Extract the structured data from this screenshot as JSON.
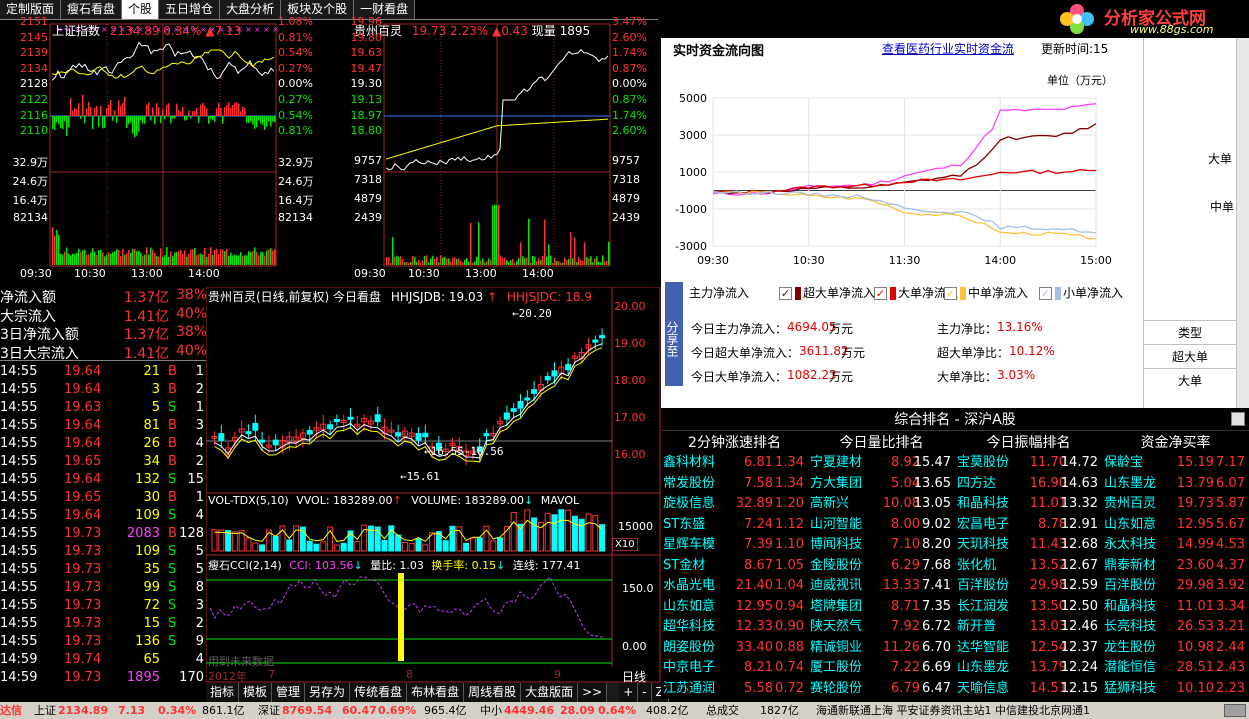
{
  "tabs": [
    "定制版面",
    "瘦石看盘",
    "个股",
    "五日增仓",
    "大盘分析",
    "板块及个股",
    "一财看盘"
  ],
  "active_tab": 2,
  "logo": {
    "name": "分析家公式网",
    "url": "www.88gs.com"
  },
  "index_chart": {
    "title": "上证指数",
    "price": "2134.89",
    "pct": "0.34%",
    "chg": "▲7.13",
    "left_ticks": [
      "2151",
      "2145",
      "2139",
      "2134",
      "2128",
      "2122",
      "2116",
      "2110"
    ],
    "right_ticks": [
      "1.08%",
      "0.81%",
      "0.54%",
      "0.27%",
      "0.00%",
      "0.27%",
      "0.54%",
      "0.81%"
    ],
    "vol_left": [
      "32.9万",
      "24.6万",
      "16.4万",
      "82134"
    ],
    "vol_right": [
      "32.9万",
      "24.6万",
      "16.4万",
      "82134"
    ],
    "times": [
      "09:30",
      "10:30",
      "13:00",
      "14:00"
    ]
  },
  "stock_chart": {
    "title": "贵州百灵",
    "price": "19.73",
    "pct": "2.23%",
    "chg": "▲0.43",
    "extra": "现量 1895",
    "left_ticks": [
      "19.96",
      "19.80",
      "19.63",
      "19.47",
      "19.30",
      "19.13",
      "18.97",
      "18.80"
    ],
    "right_ticks": [
      "3.47%",
      "2.60%",
      "1.74%",
      "0.87%",
      "0.00%",
      "0.87%",
      "1.74%",
      "2.60%"
    ],
    "vol_left": [
      "9757",
      "7318",
      "4879",
      "2439"
    ],
    "vol_right": [
      "9757",
      "7318",
      "4879",
      "2439"
    ],
    "times": [
      "09:30",
      "10:30",
      "13:00",
      "14:00"
    ]
  },
  "flows": [
    {
      "label": "净流入额",
      "value": "1.37亿",
      "pct": "38%"
    },
    {
      "label": "大宗流入",
      "value": "1.41亿",
      "pct": "40%"
    },
    {
      "label": "3日净流入额",
      "value": "1.37亿",
      "pct": "38%"
    },
    {
      "label": "3日大宗流入",
      "value": "1.41亿",
      "pct": "40%"
    }
  ],
  "trades": [
    {
      "t": "14:55",
      "p": "19.64",
      "v": "21",
      "bs": "B",
      "n": "1"
    },
    {
      "t": "14:55",
      "p": "19.64",
      "v": "3",
      "bs": "B",
      "n": "2"
    },
    {
      "t": "14:55",
      "p": "19.63",
      "v": "5",
      "bs": "S",
      "n": "1"
    },
    {
      "t": "14:55",
      "p": "19.64",
      "v": "81",
      "bs": "B",
      "n": "3"
    },
    {
      "t": "14:55",
      "p": "19.64",
      "v": "26",
      "bs": "B",
      "n": "4"
    },
    {
      "t": "14:55",
      "p": "19.65",
      "v": "34",
      "bs": "B",
      "n": "2"
    },
    {
      "t": "14:55",
      "p": "19.64",
      "v": "132",
      "bs": "S",
      "n": "15"
    },
    {
      "t": "14:55",
      "p": "19.65",
      "v": "30",
      "bs": "B",
      "n": "1"
    },
    {
      "t": "14:55",
      "p": "19.64",
      "v": "109",
      "bs": "S",
      "n": "4"
    },
    {
      "t": "14:55",
      "p": "19.73",
      "v": "2083",
      "bs": "B",
      "n": "128"
    },
    {
      "t": "14:55",
      "p": "19.73",
      "v": "109",
      "bs": "S",
      "n": "5"
    },
    {
      "t": "14:55",
      "p": "19.73",
      "v": "35",
      "bs": "S",
      "n": "5"
    },
    {
      "t": "14:55",
      "p": "19.73",
      "v": "99",
      "bs": "S",
      "n": "8"
    },
    {
      "t": "14:55",
      "p": "19.73",
      "v": "72",
      "bs": "S",
      "n": "3"
    },
    {
      "t": "14:55",
      "p": "19.73",
      "v": "15",
      "bs": "S",
      "n": "2"
    },
    {
      "t": "14:55",
      "p": "19.73",
      "v": "136",
      "bs": "S",
      "n": "9"
    },
    {
      "t": "14:59",
      "p": "19.74",
      "v": "65",
      "bs": "",
      "n": "4"
    },
    {
      "t": "14:59",
      "p": "19.73",
      "v": "1895",
      "bs": "",
      "n": "170"
    }
  ],
  "kline": {
    "title": "贵州百灵(日线,前复权) 今日看盘",
    "ind1": "HHJSJDB: 19.03",
    "ind2": "HHJSJDC: 18.9",
    "price_ticks": [
      "20.00",
      "19.00",
      "18.00",
      "17.00",
      "16.00"
    ],
    "high_label": "20.20",
    "mid_label": "16.55-16.56",
    "low_label": "15.61",
    "vol_title": "VOL-TDX(5,10)",
    "vvol": "VVOL: 183289.00",
    "volume": "VOLUME: 183289.00",
    "mavol": "MAVOL",
    "vol_tick": "15000",
    "vol_unit": "X10",
    "cci_title": "瘦石CCI(2,14)",
    "cci": "CCI: 103.56",
    "lb": "量比: 1.03",
    "hsl": "换手率: 0.15",
    "lx": "连线: 177.41",
    "cci_ticks": [
      "150.0",
      "0.00"
    ],
    "future": "用到未来数据",
    "months": [
      "2012年",
      "7",
      "8",
      "9"
    ],
    "period": "日线"
  },
  "toolbar": [
    "指标",
    "模板",
    "管理",
    "另存为",
    "传统看盘",
    "布林看盘",
    "周线看股",
    "大盘版面",
    ">>"
  ],
  "toolbar_right": [
    "+",
    "-",
    "Z"
  ],
  "flow_panel": {
    "title": "实时资金流向图",
    "link": "查看医药行业实时资金流",
    "link2": "更新时间:15",
    "unit": "单位（万元）",
    "y_ticks": [
      "5000",
      "3000",
      "1000",
      "-1000",
      "-3000"
    ],
    "x_ticks": [
      "09:30",
      "10:30",
      "11:30",
      "14:00",
      "15:00"
    ],
    "legend": [
      {
        "name": "主力净流入",
        "color": "#ff40ff"
      },
      {
        "name": "超大单净流入",
        "color": "#800000"
      },
      {
        "name": "大单净流入",
        "color": "#e00000"
      },
      {
        "name": "中单净流入",
        "color": "#ffc040"
      },
      {
        "name": "小单净流入",
        "color": "#a0c0e0"
      }
    ],
    "share_btn": "分享至",
    "stats": [
      {
        "label": "今日主力净流入：",
        "value": "4694.05",
        "unit": "万元",
        "label2": "主力净比：",
        "value2": "13.16%"
      },
      {
        "label": "今日超大单净流入：",
        "value": "3611.82",
        "unit": "万元",
        "label2": "超大单净比：",
        "value2": "10.12%"
      },
      {
        "label": "今日大单净流入：",
        "value": "1082.23",
        "unit": "万元",
        "label2": "大单净比：",
        "value2": "3.03%"
      }
    ],
    "side_labels": [
      "大单",
      "中单"
    ],
    "side_table": [
      "类型",
      "超大单",
      "大单"
    ]
  },
  "chart_data": {
    "type": "line",
    "title": "实时资金流向图",
    "ylabel": "单位（万元）",
    "x": [
      "09:30",
      "10:30",
      "11:30",
      "14:00",
      "15:00"
    ],
    "ylim": [
      -3000,
      5000
    ],
    "series": [
      {
        "name": "主力净流入",
        "color": "#ff40ff",
        "values": [
          -200,
          200,
          800,
          4300,
          4694
        ]
      },
      {
        "name": "超大单净流入",
        "color": "#800000",
        "values": [
          -100,
          100,
          400,
          2800,
          3612
        ]
      },
      {
        "name": "大单净流入",
        "color": "#e00000",
        "values": [
          -100,
          200,
          500,
          1000,
          1082
        ]
      },
      {
        "name": "中单净流入",
        "color": "#ffc040",
        "values": [
          -100,
          -300,
          -1200,
          -2300,
          -2600
        ]
      },
      {
        "name": "小单净流入",
        "color": "#a0c0e0",
        "values": [
          -100,
          -200,
          -1000,
          -2000,
          -2300
        ]
      }
    ]
  },
  "ranking": {
    "title": "综合排名 - 深沪A股",
    "columns": [
      {
        "header": "2分钟涨速排名",
        "rows": [
          [
            "鑫科材料",
            "6.81",
            "1.34"
          ],
          [
            "常发股份",
            "7.58",
            "1.34"
          ],
          [
            "旋极信息",
            "32.89",
            "1.20"
          ],
          [
            "ST东盛",
            "7.24",
            "1.12"
          ],
          [
            "星辉车模",
            "7.39",
            "1.10"
          ],
          [
            "ST金材",
            "8.67",
            "1.05"
          ],
          [
            "水晶光电",
            "21.40",
            "1.04"
          ],
          [
            "山东如意",
            "12.95",
            "0.94"
          ],
          [
            "超华科技",
            "12.33",
            "0.90"
          ],
          [
            "朗姿股份",
            "33.40",
            "0.88"
          ],
          [
            "中京电子",
            "8.21",
            "0.74"
          ],
          [
            "江苏通润",
            "5.58",
            "0.72"
          ]
        ]
      },
      {
        "header": "今日量比排名",
        "rows": [
          [
            "宁夏建材",
            "8.92",
            "15.47"
          ],
          [
            "方大集团",
            "5.04",
            "13.65"
          ],
          [
            "高新兴",
            "10.08",
            "13.05"
          ],
          [
            "山河智能",
            "8.00",
            "9.02"
          ],
          [
            "博闻科技",
            "7.10",
            "8.20"
          ],
          [
            "金陵股份",
            "6.29",
            "7.68"
          ],
          [
            "迪威视讯",
            "13.33",
            "7.41"
          ],
          [
            "塔牌集团",
            "8.71",
            "7.35"
          ],
          [
            "陕天然气",
            "7.92",
            "6.72"
          ],
          [
            "精诚铜业",
            "11.26",
            "6.70"
          ],
          [
            "厦工股份",
            "7.22",
            "6.69"
          ],
          [
            "赛轮股份",
            "6.79",
            "6.47"
          ]
        ]
      },
      {
        "header": "今日振幅排名",
        "rows": [
          [
            "宝莫股份",
            "11.70",
            "14.72"
          ],
          [
            "四方达",
            "16.90",
            "14.63"
          ],
          [
            "和晶科技",
            "11.01",
            "13.32"
          ],
          [
            "宏昌电子",
            "8.78",
            "12.91"
          ],
          [
            "天玑科技",
            "11.43",
            "12.68"
          ],
          [
            "张化机",
            "13.52",
            "12.67"
          ],
          [
            "百洋股份",
            "29.98",
            "12.59"
          ],
          [
            "长江润发",
            "13.50",
            "12.50"
          ],
          [
            "新开普",
            "13.03",
            "12.46"
          ],
          [
            "达华智能",
            "12.54",
            "12.37"
          ],
          [
            "山东墨龙",
            "13.79",
            "12.24"
          ],
          [
            "天喻信息",
            "14.51",
            "12.15"
          ]
        ]
      },
      {
        "header": "资金净买率",
        "rows": [
          [
            "保龄宝",
            "15.19",
            "7.17"
          ],
          [
            "山东墨龙",
            "13.79",
            "6.07"
          ],
          [
            "贵州百灵",
            "19.73",
            "5.87"
          ],
          [
            "山东如意",
            "12.95",
            "5.67"
          ],
          [
            "永太科技",
            "14.99",
            "4.53"
          ],
          [
            "鼎泰新材",
            "23.60",
            "4.37"
          ],
          [
            "百洋股份",
            "29.98",
            "3.92"
          ],
          [
            "和晶科技",
            "11.01",
            "3.34"
          ],
          [
            "长亮科技",
            "26.53",
            "3.21"
          ],
          [
            "龙生股份",
            "10.98",
            "2.44"
          ],
          [
            "潜能恒信",
            "28.51",
            "2.43"
          ],
          [
            "猛狮科技",
            "10.10",
            "2.23"
          ]
        ]
      }
    ]
  },
  "status": {
    "brand": "达信",
    "sh_label": "上证",
    "sh_val": "2134.89",
    "sh_chg": "7.13",
    "sh_pct": "0.34%",
    "sh_amt": "861.1亿",
    "sz_label": "深证",
    "sz_val": "8769.54",
    "sz_chg": "60.47",
    "sz_pct": "0.69%",
    "sz_amt": "965.4亿",
    "zx_label": "中小",
    "zx_val": "4449.46",
    "zx_chg": "28.09",
    "zx_pct": "0.64%",
    "zx_amt": "408.2亿",
    "total_label": "总成交",
    "total_val": "1827亿",
    "server": "海通新联通上海   平安证券资讯主站1   中信建投北京网通1"
  }
}
